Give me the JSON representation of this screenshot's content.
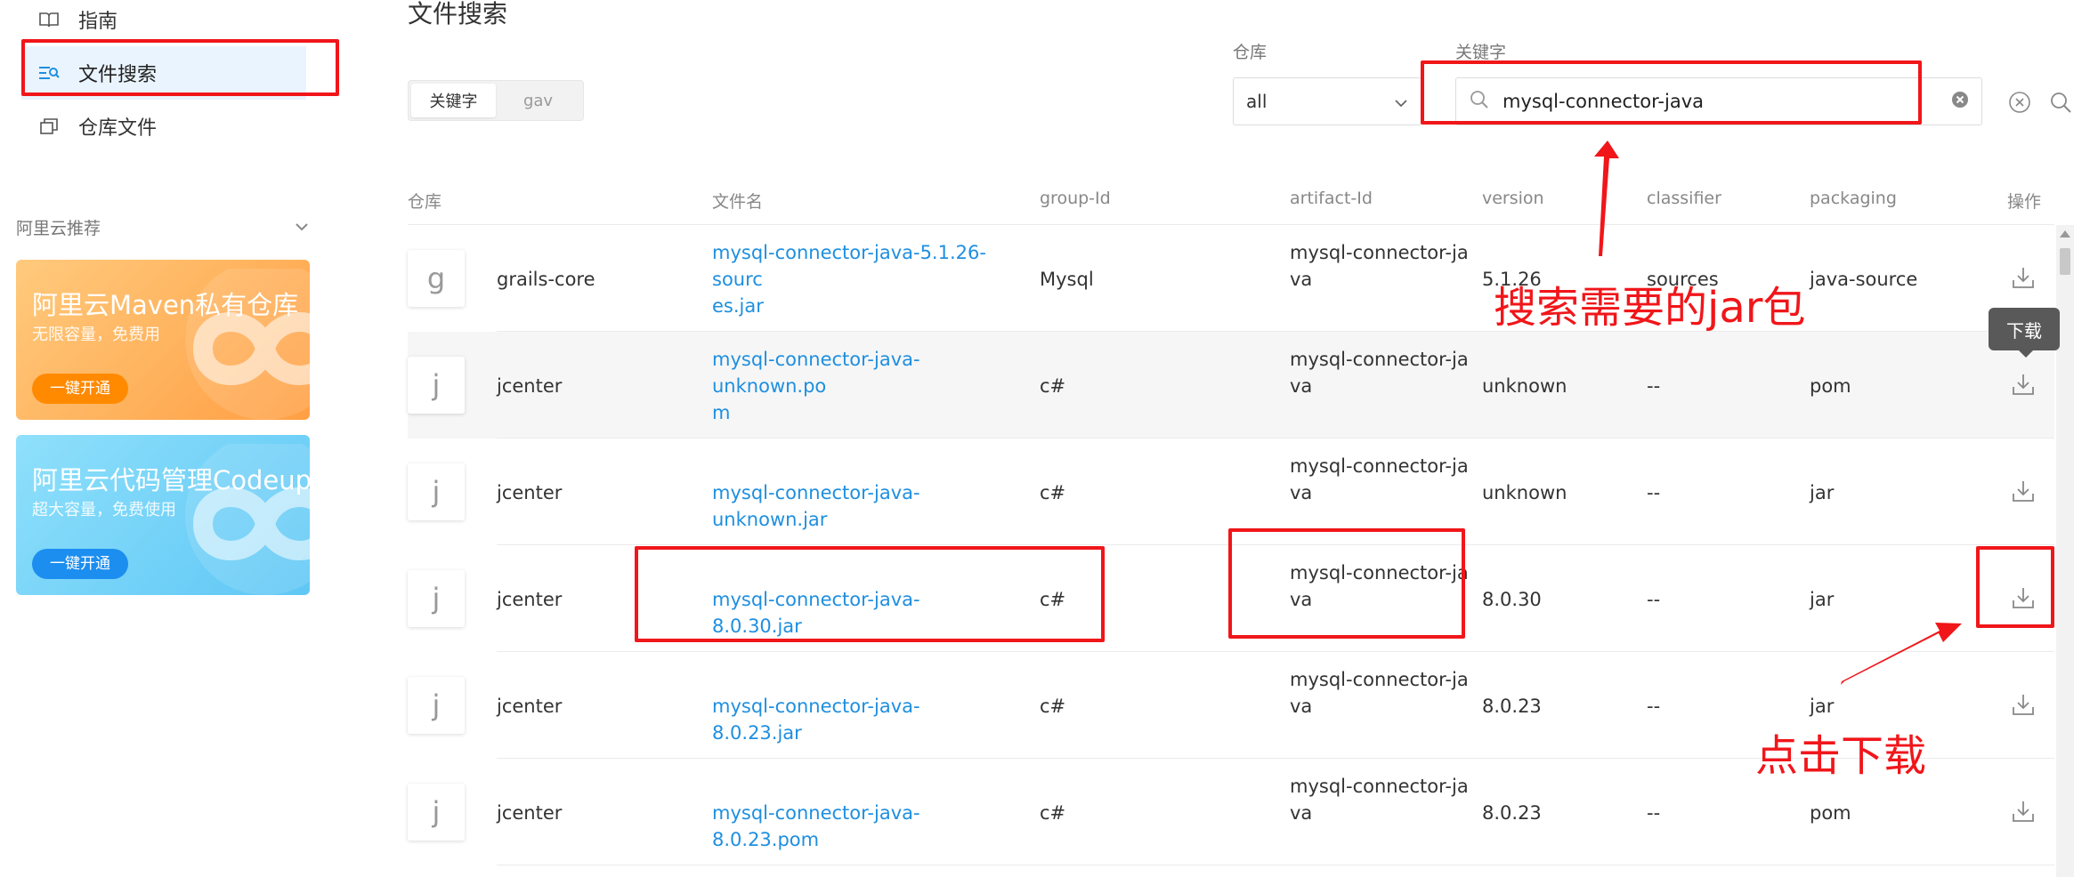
{
  "sidebar": {
    "items": [
      {
        "label": "指南",
        "icon": "book-icon"
      },
      {
        "label": "文件搜索",
        "icon": "file-search-icon"
      },
      {
        "label": "仓库文件",
        "icon": "copy-icon"
      }
    ],
    "section_title": "阿里云推荐",
    "promos": [
      {
        "title": "阿里云Maven私有仓库",
        "subtitle": "无限容量，免费用",
        "button": "一键开通",
        "bg_from": "#ffca7d",
        "bg_to": "#ff9f43",
        "btn_color": "#ff8a00"
      },
      {
        "title": "阿里云代码管理Codeup",
        "subtitle": "超大容量，免费使用",
        "button": "一键开通",
        "bg_from": "#8fe0fb",
        "bg_to": "#5fc7f5",
        "btn_color": "#1b8ef0"
      }
    ]
  },
  "main": {
    "title": "文件搜索",
    "toggle": {
      "left": "关键字",
      "right": "gav"
    },
    "repo_label": "仓库",
    "repo_value": "all",
    "keyword_label": "关键字",
    "keyword_value": "mysql-connector-java"
  },
  "table": {
    "headers": [
      "仓库",
      "文件名",
      "group-Id",
      "artifact-Id",
      "version",
      "classifier",
      "packaging",
      "操作"
    ],
    "rows": [
      {
        "avatar": "g",
        "repo": "grails-core",
        "file_1": "mysql-connector-java-5.1.26-sourc",
        "file_2": "es.jar",
        "group": "Mysql",
        "artifact_1": "mysql-connector-ja",
        "artifact_2": "va",
        "version": "5.1.26",
        "classifier": "sources",
        "packaging": "java-source"
      },
      {
        "avatar": "j",
        "repo": "jcenter",
        "file_1": "mysql-connector-java-unknown.po",
        "file_2": "m",
        "group": "c#",
        "artifact_1": "mysql-connector-ja",
        "artifact_2": "va",
        "version": "unknown",
        "classifier": "--",
        "packaging": "pom"
      },
      {
        "avatar": "j",
        "repo": "jcenter",
        "file_1": "mysql-connector-java-unknown.jar",
        "file_2": "",
        "group": "c#",
        "artifact_1": "mysql-connector-ja",
        "artifact_2": "va",
        "version": "unknown",
        "classifier": "--",
        "packaging": "jar"
      },
      {
        "avatar": "j",
        "repo": "jcenter",
        "file_1": "mysql-connector-java-8.0.30.jar",
        "file_2": "",
        "group": "c#",
        "artifact_1": "mysql-connector-ja",
        "artifact_2": "va",
        "version": "8.0.30",
        "classifier": "--",
        "packaging": "jar"
      },
      {
        "avatar": "j",
        "repo": "jcenter",
        "file_1": "mysql-connector-java-8.0.23.jar",
        "file_2": "",
        "group": "c#",
        "artifact_1": "mysql-connector-ja",
        "artifact_2": "va",
        "version": "8.0.23",
        "classifier": "--",
        "packaging": "jar"
      },
      {
        "avatar": "j",
        "repo": "jcenter",
        "file_1": "mysql-connector-java-8.0.23.pom",
        "file_2": "",
        "group": "c#",
        "artifact_1": "mysql-connector-ja",
        "artifact_2": "va",
        "version": "8.0.23",
        "classifier": "--",
        "packaging": "pom"
      }
    ]
  },
  "tooltip": "下载",
  "annotations": {
    "search_note": "搜索需要的jar包",
    "download_note": "点击下载",
    "color": "#f0161a"
  },
  "colors": {
    "link": "#1e8fe0",
    "active_nav_bg": "#eaf4fe",
    "alt_row_bg": "#f6f6f6"
  }
}
